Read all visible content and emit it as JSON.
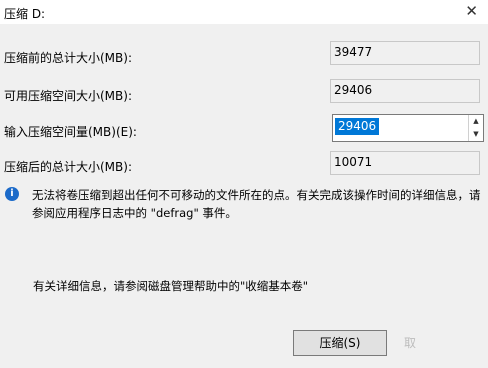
{
  "window": {
    "title": "压缩 D:",
    "close_glyph": "✕"
  },
  "fields": [
    {
      "label": "压缩前的总计大小(MB):",
      "value": "39477"
    },
    {
      "label": "可用压缩空间大小(MB):",
      "value": "29406"
    },
    {
      "label": "输入压缩空间量(MB)(E):",
      "value": "29406"
    },
    {
      "label": "压缩后的总计大小(MB):",
      "value": "10071"
    }
  ],
  "spinner": {
    "up_glyph": "▲",
    "down_glyph": "▼"
  },
  "info": {
    "icon": "info-icon",
    "icon_glyph": "i",
    "text": "无法将卷压缩到超出任何不可移动的文件所在的点。有关完成该操作时间的详细信息，请参阅应用程序日志中的 \"defrag\" 事件。"
  },
  "help_text": "有关详细信息，请参阅磁盘管理帮助中的\"收缩基本卷\"",
  "buttons": {
    "shrink": "压缩(S)",
    "cancel_partial": "取"
  },
  "colors": {
    "selection": "#0078d7",
    "info": "#1b6ac9",
    "dialog_bg": "#f0f0f0"
  }
}
